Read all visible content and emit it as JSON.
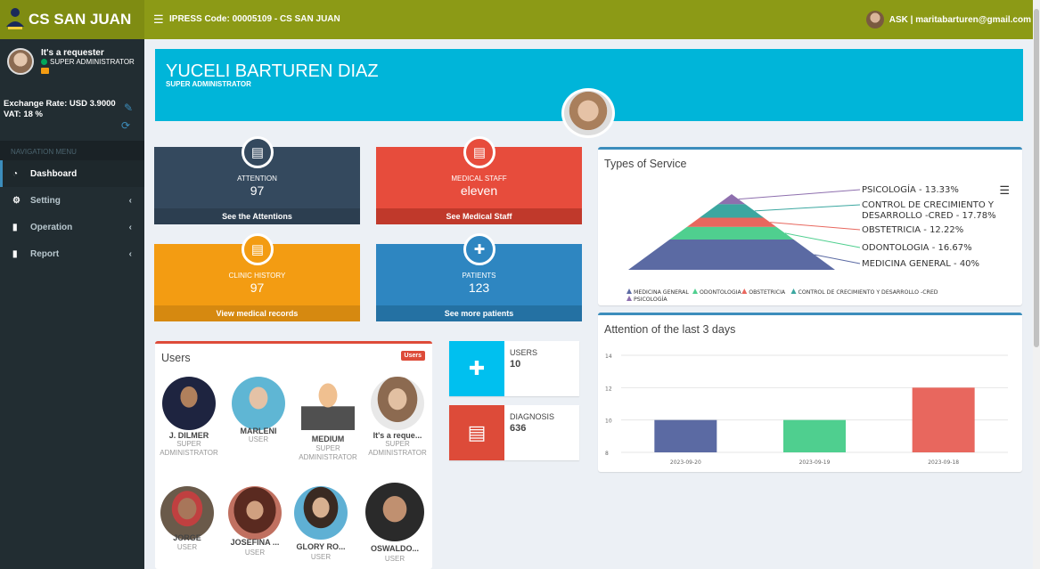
{
  "app": {
    "title": "CS SAN JUAN",
    "ipress": "IPRESS Code: 00005109 - CS SAN JUAN"
  },
  "topbar": {
    "user_email": "ASK | maritabarturen@gmail.com"
  },
  "sidebar": {
    "user_name": "It's a requester",
    "user_role": "SUPER ADMINISTRATOR",
    "exchange_rate": "Exchange Rate: USD 3.9000",
    "vat": "VAT: 18 %",
    "nav_header": "NAVIGATION MENU",
    "items": [
      {
        "label": "Dashboard",
        "icon": "dashboard-icon"
      },
      {
        "label": "Setting",
        "icon": "cogs-icon"
      },
      {
        "label": "Operation",
        "icon": "file-icon"
      },
      {
        "label": "Report",
        "icon": "file-icon"
      }
    ]
  },
  "profile": {
    "name": "YUCELI BARTUREN DIAZ",
    "role": "SUPER ADMINISTRATOR"
  },
  "tiles": [
    {
      "label": "ATTENTION",
      "value": "97",
      "link": "See the Attentions",
      "color": "#34495e",
      "footer_color": "#2c3e50",
      "icon": "clipboard-icon"
    },
    {
      "label": "MEDICAL STAFF",
      "value": "eleven",
      "link": "See Medical Staff",
      "color": "#e74c3c",
      "footer_color": "#c0392b",
      "icon": "document-icon"
    },
    {
      "label": "CLINIC HISTORY",
      "value": "97",
      "link": "View medical records",
      "color": "#f39c12",
      "footer_color": "#d68910",
      "icon": "clipboard-icon"
    },
    {
      "label": "PATIENTS",
      "value": "123",
      "link": "See more patients",
      "color": "#2e86c1",
      "footer_color": "#2471a3",
      "icon": "add-user-icon"
    }
  ],
  "users_card": {
    "title": "Users",
    "badge": "Users",
    "users": [
      {
        "name": "J. DILMER",
        "role_line1": "SUPER",
        "role_line2": "ADMINISTRATOR"
      },
      {
        "name": "MARLENI",
        "role_line1": "USER",
        "role_line2": ""
      },
      {
        "name": "MEDIUM",
        "role_line1": "SUPER",
        "role_line2": "ADMINISTRATOR"
      },
      {
        "name": "It's a reque...",
        "role_line1": "SUPER",
        "role_line2": "ADMINISTRATOR"
      },
      {
        "name": "JORGE",
        "role_line1": "USER",
        "role_line2": ""
      },
      {
        "name": "JOSEFINA ...",
        "role_line1": "USER",
        "role_line2": ""
      },
      {
        "name": "GLORY RO...",
        "role_line1": "USER",
        "role_line2": ""
      },
      {
        "name": "OSWALDO...",
        "role_line1": "USER",
        "role_line2": ""
      }
    ]
  },
  "infoboxes": [
    {
      "label": "USERS",
      "value": "10",
      "color": "#00c0ef",
      "icon": "add-user-icon"
    },
    {
      "label": "DIAGNOSIS",
      "value": "636",
      "color": "#dd4b39",
      "icon": "receipt-icon"
    }
  ],
  "chart_data": [
    {
      "type": "pyramid",
      "title": "Types of Service",
      "slices": [
        {
          "name": "PSICOLOGÍA",
          "label": "PSICOLOGÍA - 13.33%",
          "value": 13.33,
          "color": "#8e6fae"
        },
        {
          "name": "CONTROL DE CRECIMIENTO Y DESARROLLO -CRED",
          "label_line1": "CONTROL DE CRECIMIENTO Y",
          "label_line2": "DESARROLLO -CRED - 17.78%",
          "value": 17.78,
          "color": "#3ba7a0"
        },
        {
          "name": "OBSTETRICIA",
          "label": "OBSTETRICIA - 12.22%",
          "value": 12.22,
          "color": "#e8675e"
        },
        {
          "name": "ODONTOLOGIA",
          "label": "ODONTOLOGIA - 16.67%",
          "value": 16.67,
          "color": "#4fcf8f"
        },
        {
          "name": "MEDICINA GENERAL",
          "label": "MEDICINA GENERAL - 40%",
          "value": 40,
          "color": "#5b6aa3"
        }
      ],
      "legend": [
        {
          "name": "MEDICINA GENERAL",
          "color": "#5b6aa3"
        },
        {
          "name": "ODONTOLOGIA",
          "color": "#4fcf8f"
        },
        {
          "name": "OBSTETRICIA",
          "color": "#e8675e"
        },
        {
          "name": "CONTROL DE CRECIMIENTO Y DESARROLLO -CRED",
          "color": "#3ba7a0"
        },
        {
          "name": "PSICOLOGÍA",
          "color": "#8e6fae"
        }
      ],
      "legend_position": "bottom"
    },
    {
      "type": "bar",
      "title": "Attention of the last 3 days",
      "categories": [
        "2023-09-20",
        "2023-09-19",
        "2023-09-18"
      ],
      "values": [
        10,
        10,
        12
      ],
      "colors": [
        "#5b6aa3",
        "#4fcf8f",
        "#e8675e"
      ],
      "ylim": [
        8,
        14
      ],
      "yticks": [
        8,
        10,
        12,
        14
      ],
      "grid": true
    }
  ]
}
